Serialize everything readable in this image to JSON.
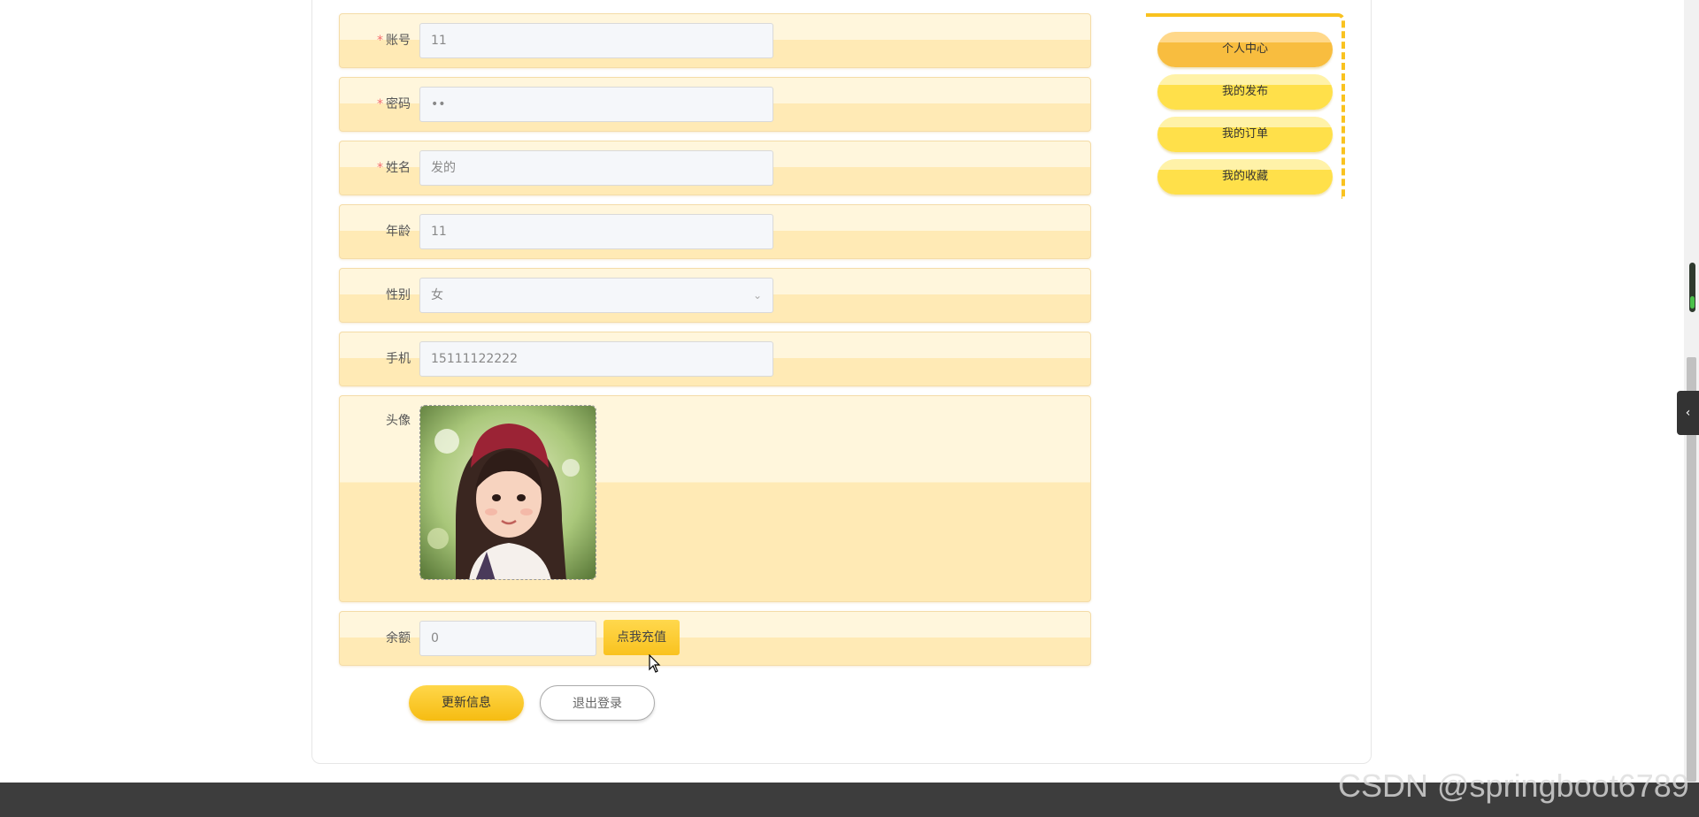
{
  "form": {
    "fields": [
      {
        "label": "账号",
        "required": true,
        "value": "11"
      },
      {
        "label": "密码",
        "required": true,
        "value": "••"
      },
      {
        "label": "姓名",
        "required": true,
        "value": "发的"
      },
      {
        "label": "年龄",
        "required": false,
        "value": "11"
      },
      {
        "label": "性别",
        "required": false,
        "value": "女"
      },
      {
        "label": "手机",
        "required": false,
        "value": "15111122222"
      }
    ],
    "required_mark": "*",
    "avatar_label": "头像",
    "balance": {
      "label": "余额",
      "value": "0",
      "recharge_label": "点我充值"
    },
    "update_button": "更新信息",
    "logout_button": "退出登录"
  },
  "sidebar": {
    "items": [
      {
        "label": "个人中心",
        "active": true
      },
      {
        "label": "我的发布",
        "active": false
      },
      {
        "label": "我的订单",
        "active": false
      },
      {
        "label": "我的收藏",
        "active": false
      }
    ]
  },
  "colors": {
    "accent": "#f9c21f",
    "row_bg": "#ffeab5",
    "required": "#f56c6c"
  },
  "icons": {
    "select": "chevron-down-icon",
    "side_tab": "chevron-left-icon"
  },
  "watermark": "CSDN @springboot6789"
}
